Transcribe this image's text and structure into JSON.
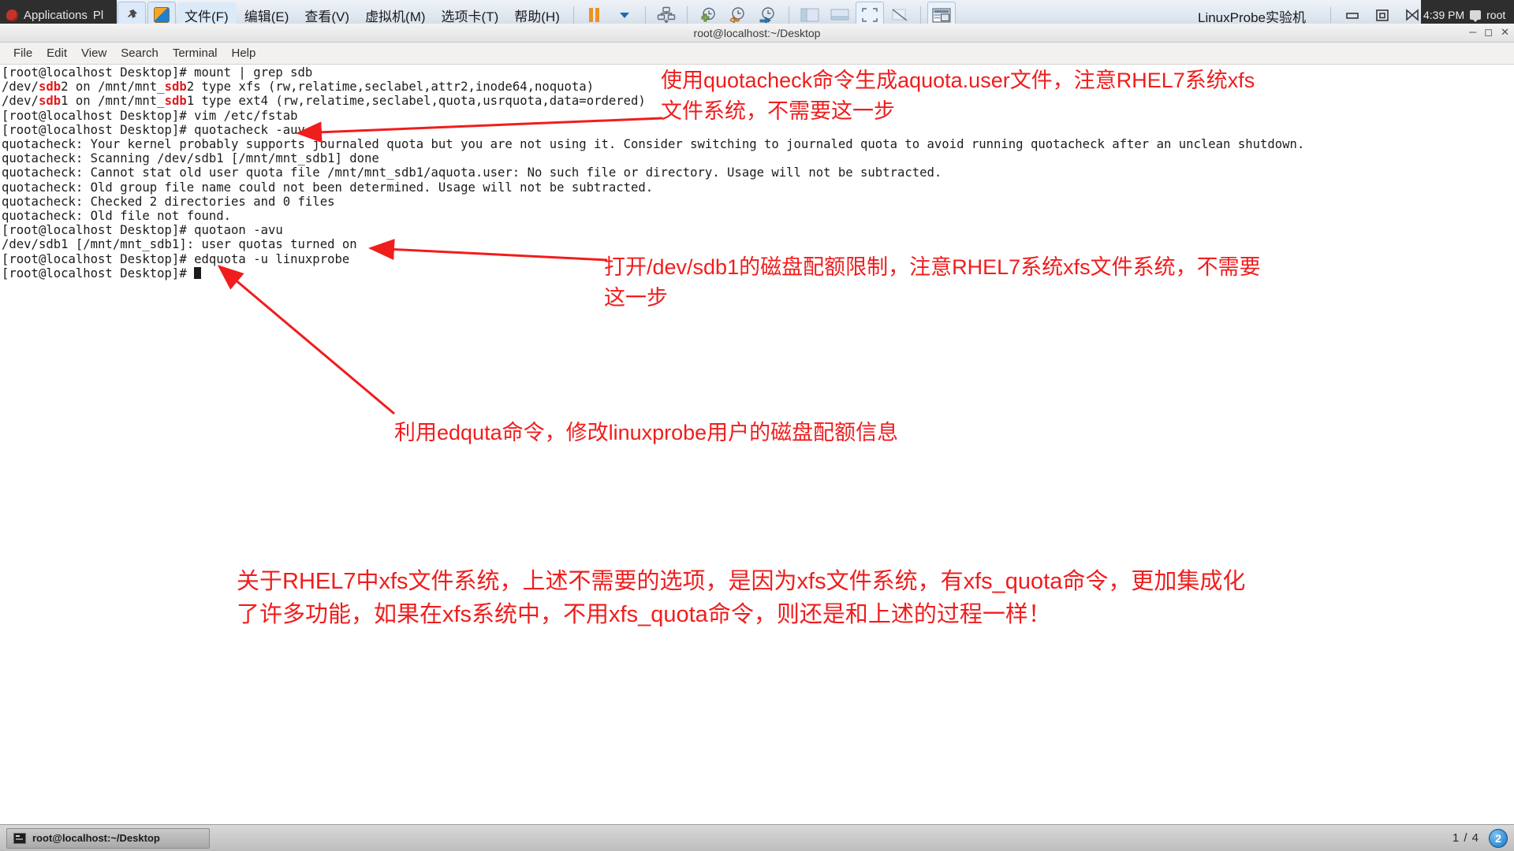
{
  "vmware": {
    "gnome_apps_label": "Applications",
    "gnome_places_label": "Pl",
    "menu": [
      {
        "label": "文件(F)",
        "name": "menu-file"
      },
      {
        "label": "编辑(E)",
        "name": "menu-edit"
      },
      {
        "label": "查看(V)",
        "name": "menu-view"
      },
      {
        "label": "虚拟机(M)",
        "name": "menu-vm"
      },
      {
        "label": "选项卡(T)",
        "name": "menu-tabs"
      },
      {
        "label": "帮助(H)",
        "name": "menu-help"
      }
    ],
    "vm_title": "LinuxProbe实验机",
    "clock": "4:39 PM",
    "user": "root",
    "accent_blue": "#1f66b5",
    "accent_orange": "#ed9121"
  },
  "terminal": {
    "title": "root@localhost:~/Desktop",
    "menubar": [
      "File",
      "Edit",
      "View",
      "Search",
      "Terminal",
      "Help"
    ],
    "prompt": "[root@localhost Desktop]# ",
    "grep_highlight": "sdb",
    "lines": [
      {
        "type": "prompt",
        "cmd": "mount | grep sdb"
      },
      {
        "type": "out-grep",
        "pre": "/dev/",
        "hl": "sdb",
        "mid": "2 on /mnt/mnt_",
        "hl2": "sdb",
        "post": "2 type xfs (rw,relatime,seclabel,attr2,inode64,noquota)"
      },
      {
        "type": "out-grep",
        "pre": "/dev/",
        "hl": "sdb",
        "mid": "1 on /mnt/mnt_",
        "hl2": "sdb",
        "post": "1 type ext4 (rw,relatime,seclabel,quota,usrquota,data=ordered)"
      },
      {
        "type": "prompt",
        "cmd": "vim /etc/fstab"
      },
      {
        "type": "prompt",
        "cmd": "quotacheck -auv"
      },
      {
        "type": "out",
        "text": "quotacheck: Your kernel probably supports journaled quota but you are not using it. Consider switching to journaled quota to avoid running quotacheck after an unclean shutdown."
      },
      {
        "type": "out",
        "text": "quotacheck: Scanning /dev/sdb1 [/mnt/mnt_sdb1] done"
      },
      {
        "type": "out",
        "text": "quotacheck: Cannot stat old user quota file /mnt/mnt_sdb1/aquota.user: No such file or directory. Usage will not be subtracted."
      },
      {
        "type": "out",
        "text": "quotacheck: Old group file name could not been determined. Usage will not be subtracted."
      },
      {
        "type": "out",
        "text": "quotacheck: Checked 2 directories and 0 files"
      },
      {
        "type": "out",
        "text": "quotacheck: Old file not found."
      },
      {
        "type": "prompt",
        "cmd": "quotaon -avu"
      },
      {
        "type": "out",
        "text": "/dev/sdb1 [/mnt/mnt_sdb1]: user quotas turned on"
      },
      {
        "type": "prompt",
        "cmd": "edquota -u linuxprobe"
      },
      {
        "type": "prompt-cursor",
        "cmd": ""
      }
    ]
  },
  "annotations": {
    "color": "#f01d1d",
    "note1": "使用quotacheck命令生成aquota.user文件，注意RHEL7系统xfs\n文件系统，不需要这一步",
    "note2": "打开/dev/sdb1的磁盘配额限制，注意RHEL7系统xfs文件系统，不需要\n这一步",
    "note3": "利用edquta命令，修改linuxprobe用户的磁盘配额信息",
    "note4": "关于RHEL7中xfs文件系统，上述不需要的选项，是因为xfs文件系统，有xfs_quota命令，更加集成化\n了许多功能，如果在xfs系统中，不用xfs_quota命令，则还是和上述的过程一样！"
  },
  "taskbar": {
    "window_label": "root@localhost:~/Desktop",
    "workspace_indicator": "1 / 4",
    "workspace_badge": "2"
  }
}
